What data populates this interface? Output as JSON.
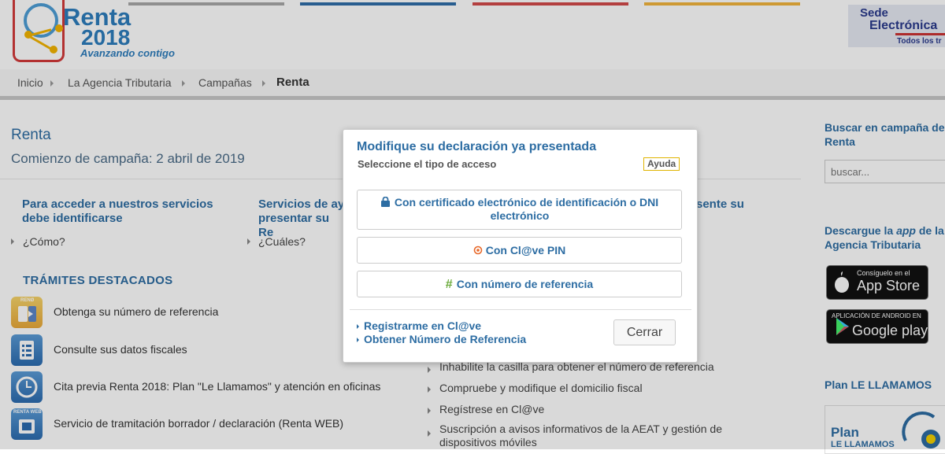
{
  "header": {
    "logo": {
      "renta": "Renta",
      "year": "2018",
      "tagline": "Avanzando contigo"
    },
    "color_bars": [
      "#a8a8a8",
      "#2f6ea8",
      "#d34a4a",
      "#f2b43c"
    ],
    "sede": {
      "line1": "Sede",
      "line2": "Electrónica",
      "line3": "Todos los tr"
    }
  },
  "breadcrumb": {
    "items": [
      "Inicio",
      "La Agencia Tributaria",
      "Campañas"
    ],
    "current": "Renta"
  },
  "main": {
    "title": "Renta",
    "subtitle": "Comienzo de campaña: 2 abril de 2019",
    "col1": {
      "heading": "Para acceder a nuestros servicios debe identificarse",
      "link": "¿Cómo?"
    },
    "col2": {
      "heading": "Servicios de ay presentar su Re",
      "link": "¿Cuáles?"
    },
    "col3_fragment": "sente su",
    "tramites": {
      "heading": "TRÁMITES DESTACADOS",
      "items": [
        {
          "label": "Obtenga su número de referencia",
          "icon": "phone-reference-icon",
          "icon_text": "RENØ"
        },
        {
          "label": "Consulte sus datos fiscales",
          "icon": "document-list-icon"
        },
        {
          "label": "Cita previa Renta 2018: Plan \"Le Llamamos\" y atención en oficinas",
          "icon": "clock-icon"
        },
        {
          "label": "Servicio de tramitación borrador / declaración (Renta WEB)",
          "icon": "renta-web-icon",
          "icon_text": "RENTA WEB"
        }
      ]
    },
    "other_links": [
      "Inhabilite la casilla para obtener el número de referencia",
      "Compruebe y modifique el domicilio fiscal",
      "Regístrese en Cl@ve",
      "Suscripción a avisos informativos de la AEAT y gestión de dispositivos móviles"
    ]
  },
  "sidebar": {
    "search": {
      "title": "Buscar en campaña de Renta",
      "placeholder": "buscar..."
    },
    "app": {
      "title_pre": "Descargue la ",
      "title_em": "app",
      "title_post": " de la Agencia Tributaria",
      "appstore": {
        "small": "Consíguelo en el",
        "big": "App Store"
      },
      "googleplay": {
        "small": "APLICACIÓN DE ANDROID EN",
        "big": "Google play"
      }
    },
    "plan": {
      "title": "Plan LE LLAMAMOS",
      "image_text1": "Plan",
      "image_text2": "LE LLAMAMOS"
    }
  },
  "modal": {
    "title": "Modifique su declaración ya presentada",
    "subtitle": "Seleccione el tipo de acceso",
    "help": "Ayuda",
    "options": [
      {
        "label": "Con certificado electrónico de identificación o DNI electrónico",
        "icon": "lock-icon",
        "icon_color": "#2d6da3"
      },
      {
        "label": "Con Cl@ve PIN",
        "icon": "clave-icon",
        "icon_color": "#e8692a"
      },
      {
        "label": "Con número de referencia",
        "icon": "hash-icon",
        "icon_color": "#6aaa3a",
        "icon_glyph": "#"
      }
    ],
    "links": [
      "Registrarme en Cl@ve",
      "Obtener Número de Referencia"
    ],
    "close": "Cerrar"
  }
}
